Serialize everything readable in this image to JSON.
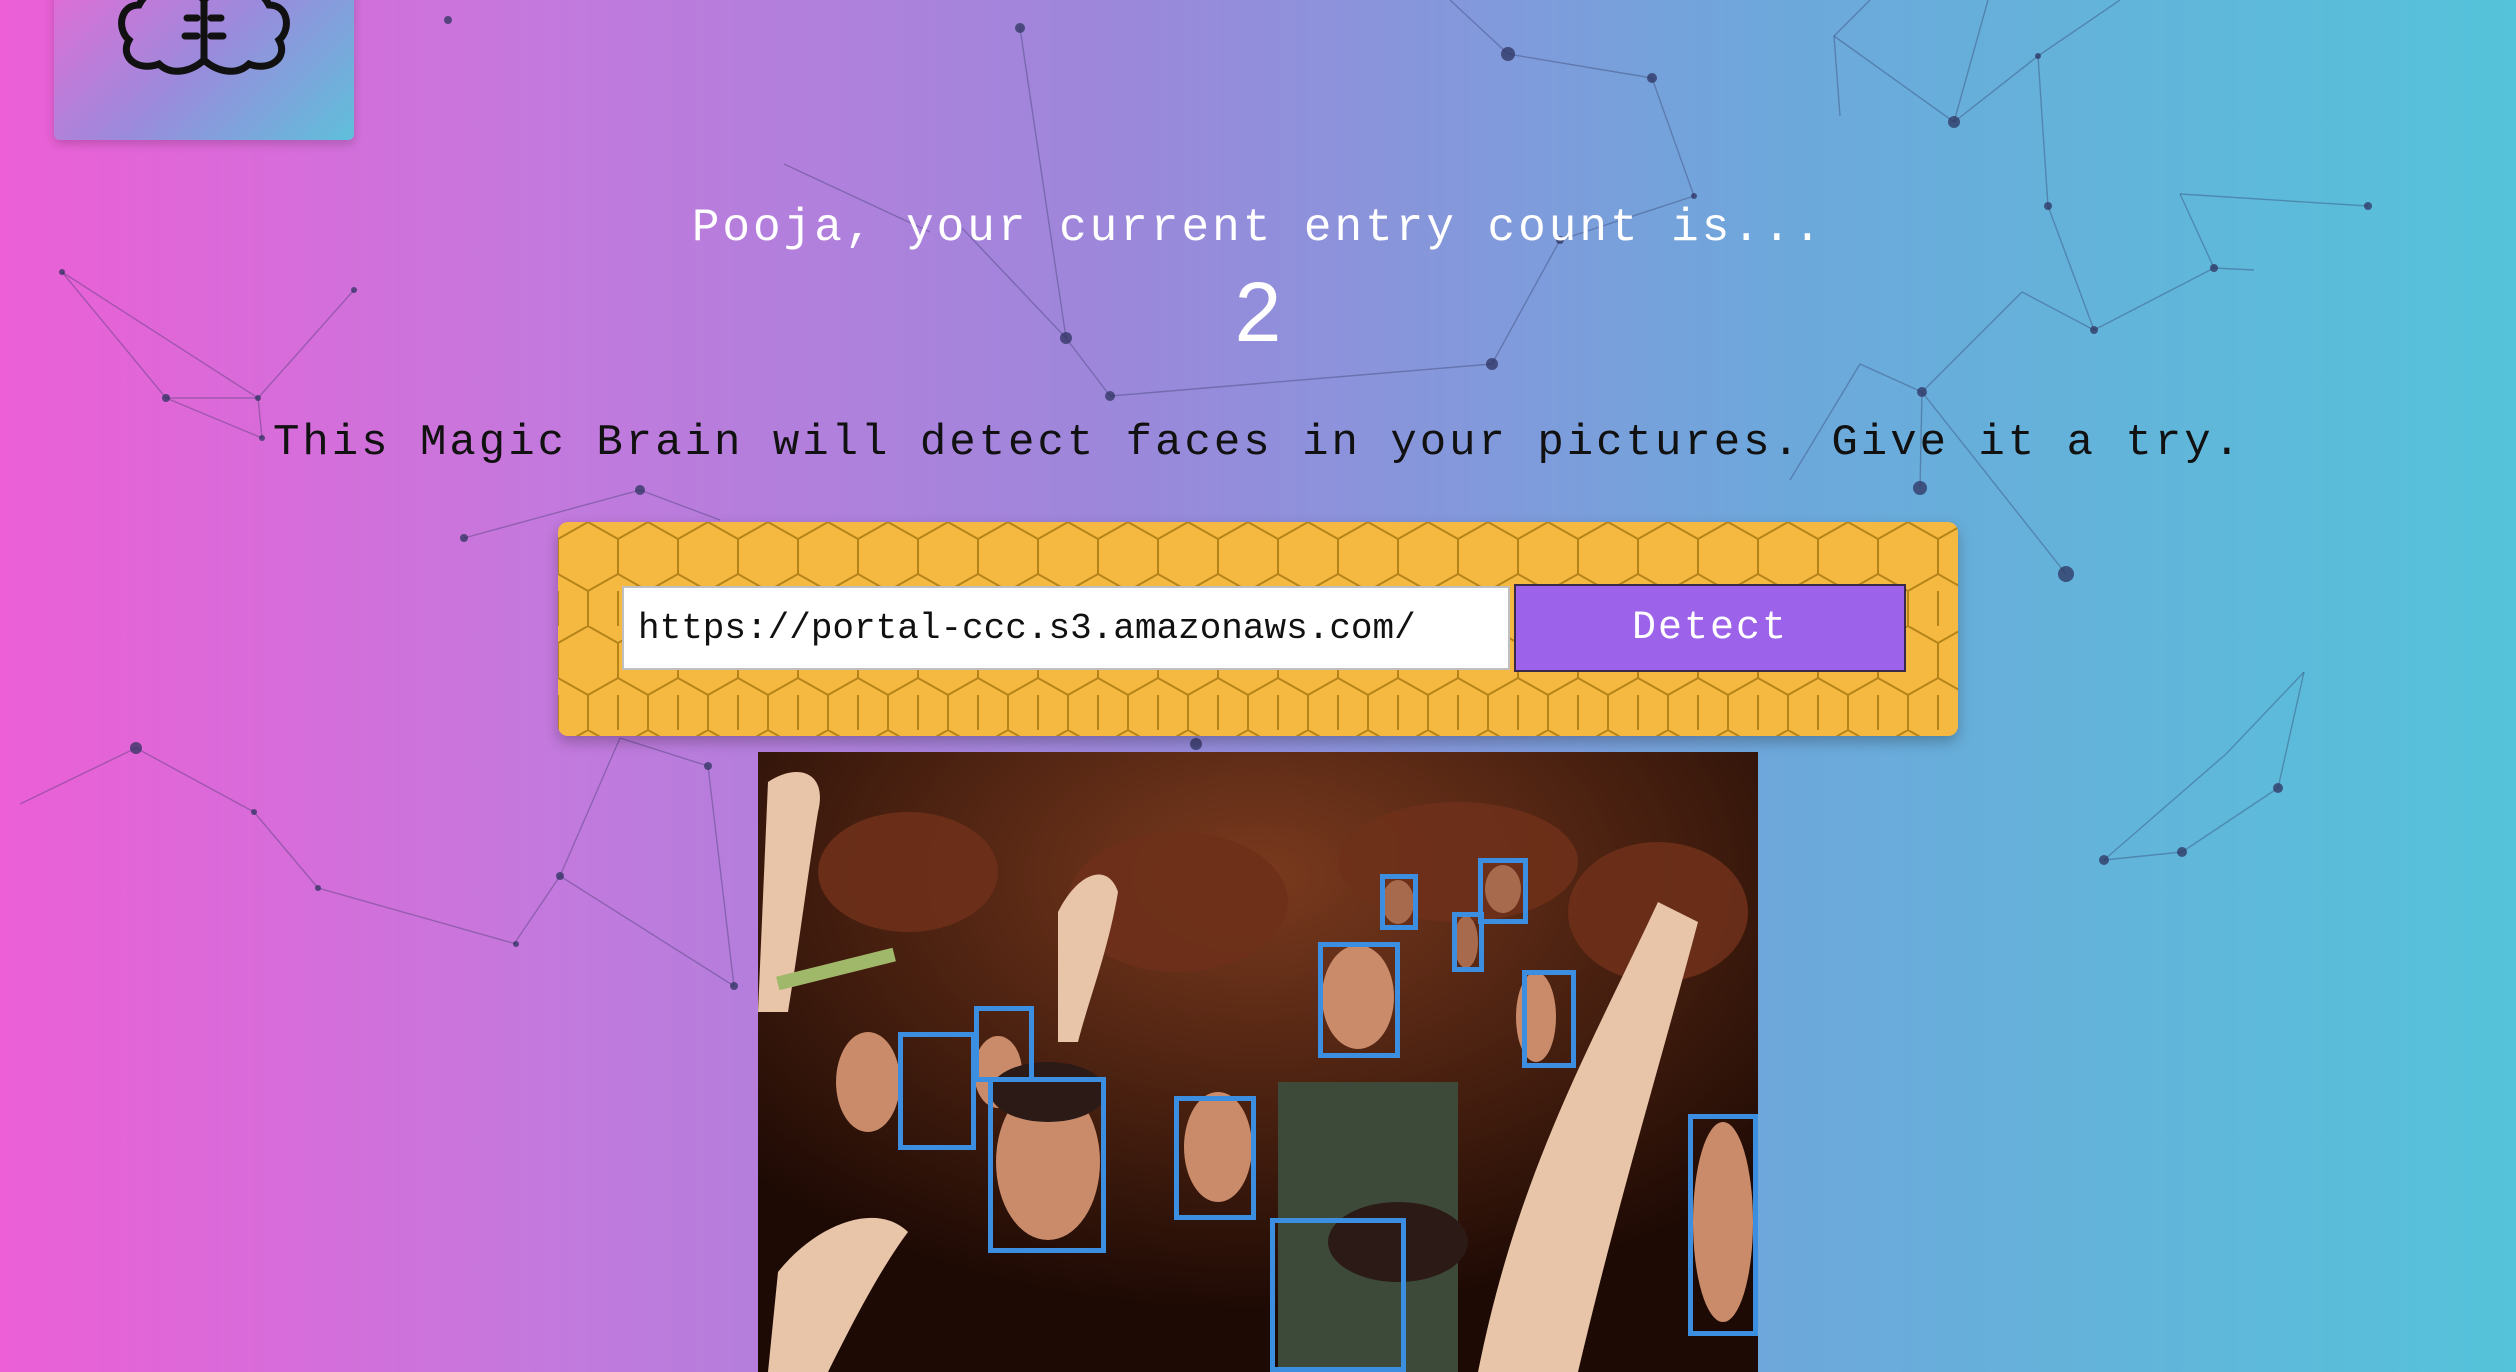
{
  "logo": {
    "icon": "brain-icon"
  },
  "greeting": "Pooja, your current entry count is...",
  "entry_count": "2",
  "tagline": "This Magic Brain will detect faces in your pictures. Give it a try.",
  "image_form": {
    "url_value": "https://portal-ccc.s3.amazonaws.com/",
    "detect_label": "Detect"
  },
  "result_image": {
    "face_count": 12
  },
  "colors": {
    "gradient_left": "#ec5fd6",
    "gradient_right": "#55c3da",
    "panel": "#f5b942",
    "button": "#9c63ea",
    "face_box": "#3c8ee0"
  }
}
